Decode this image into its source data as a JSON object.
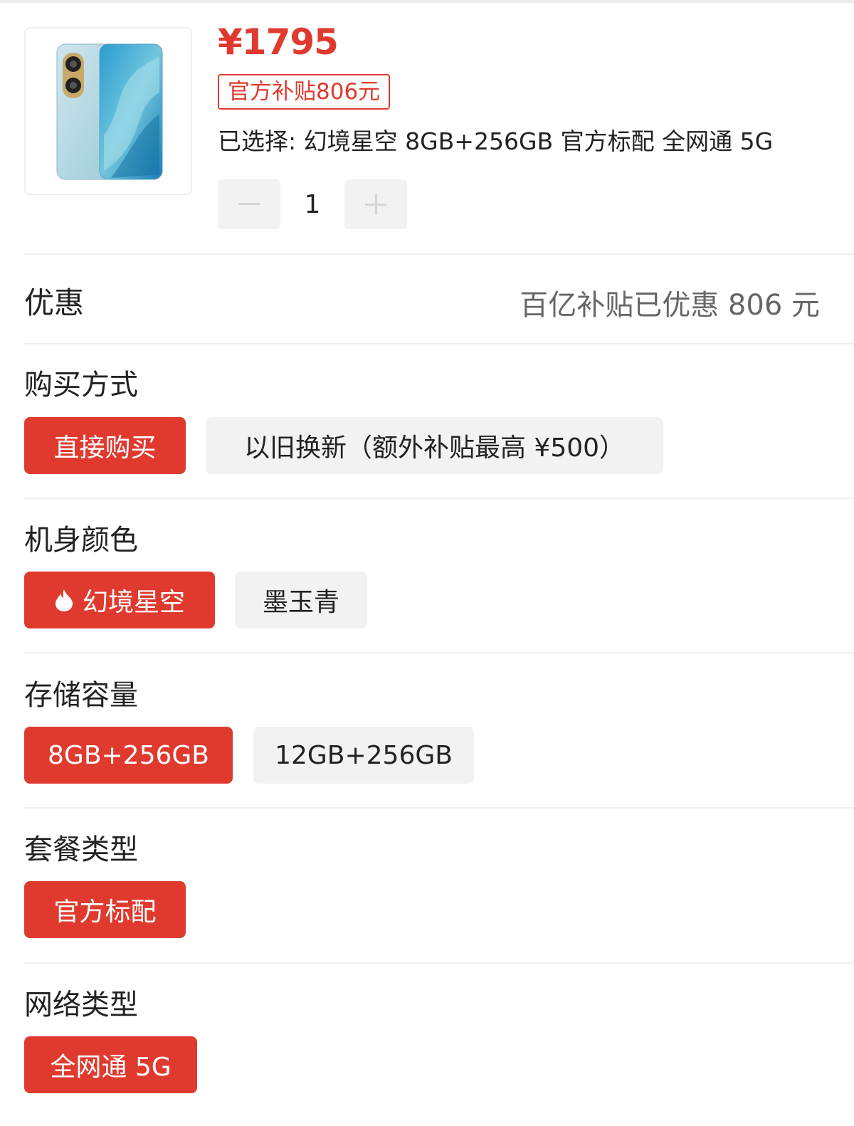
{
  "product": {
    "image_icon": "phone-product-image",
    "price": "¥1795",
    "subsidy_tag": "官方补贴806元",
    "selected": "已选择: 幻境星空 8GB+256GB 官方标配 全网通 5G",
    "quantity": "1",
    "minus_icon": "minus-icon",
    "plus_icon": "plus-icon"
  },
  "discount": {
    "title": "优惠",
    "value": "百亿补贴已优惠 806 元"
  },
  "sections": {
    "purchase": {
      "title": "购买方式",
      "options": [
        "直接购买",
        "以旧换新（额外补贴最高 ¥500）"
      ],
      "selected_index": 0
    },
    "color": {
      "title": "机身颜色",
      "options": [
        "幻境星空",
        "墨玉青"
      ],
      "selected_index": 0,
      "hot_icon": "flame-icon"
    },
    "storage": {
      "title": "存储容量",
      "options": [
        "8GB+256GB",
        "12GB+256GB"
      ],
      "selected_index": 0
    },
    "package": {
      "title": "套餐类型",
      "options": [
        "官方标配"
      ],
      "selected_index": 0
    },
    "network": {
      "title": "网络类型",
      "options": [
        "全网通 5G"
      ],
      "selected_index": 0
    }
  },
  "colors": {
    "accent": "#e03a2f",
    "unselected_bg": "#f2f2f2",
    "divider": "#eeeeee"
  }
}
